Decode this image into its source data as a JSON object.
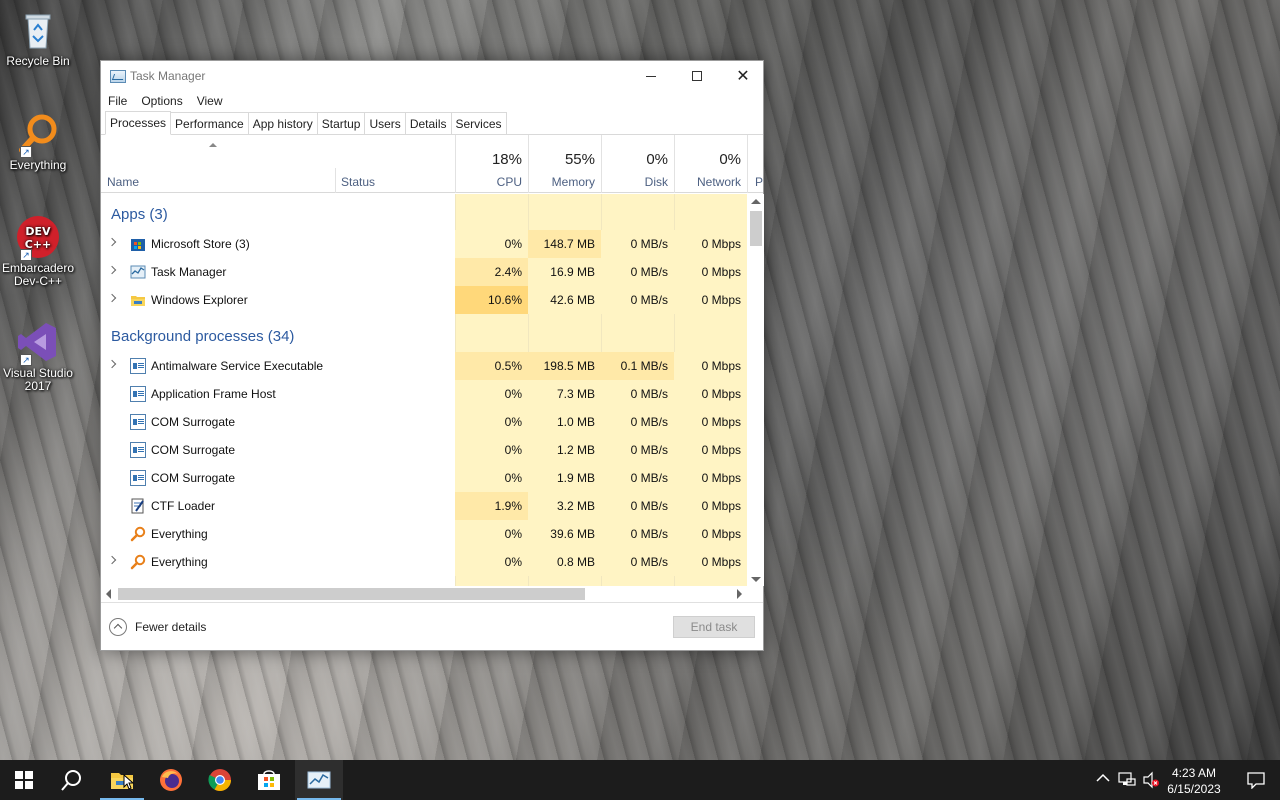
{
  "desktop": {
    "icons": [
      {
        "label": "Recycle Bin"
      },
      {
        "label": "Everything"
      },
      {
        "label": "Embarcadero Dev-C++",
        "badge": "DEV C++"
      },
      {
        "label": "Visual Studio 2017"
      }
    ]
  },
  "window": {
    "title": "Task Manager",
    "menu": [
      "File",
      "Options",
      "View"
    ],
    "tabs": [
      "Processes",
      "Performance",
      "App history",
      "Startup",
      "Users",
      "Details",
      "Services"
    ],
    "active_tab": "Processes"
  },
  "columns": {
    "name": "Name",
    "status": "Status",
    "cpu": {
      "pct": "18%",
      "label": "CPU"
    },
    "memory": {
      "pct": "55%",
      "label": "Memory"
    },
    "disk": {
      "pct": "0%",
      "label": "Disk"
    },
    "network": {
      "pct": "0%",
      "label": "Network"
    },
    "power": "P"
  },
  "groups": {
    "apps": "Apps (3)",
    "background": "Background processes (34)"
  },
  "apps": [
    {
      "name": "Microsoft Store (3)",
      "cpu": "0%",
      "memory": "148.7 MB",
      "disk": "0 MB/s",
      "network": "0 Mbps"
    },
    {
      "name": "Task Manager",
      "cpu": "2.4%",
      "memory": "16.9 MB",
      "disk": "0 MB/s",
      "network": "0 Mbps"
    },
    {
      "name": "Windows Explorer",
      "cpu": "10.6%",
      "memory": "42.6 MB",
      "disk": "0 MB/s",
      "network": "0 Mbps"
    }
  ],
  "background": [
    {
      "name": "Antimalware Service Executable",
      "cpu": "0.5%",
      "memory": "198.5 MB",
      "disk": "0.1 MB/s",
      "network": "0 Mbps"
    },
    {
      "name": "Application Frame Host",
      "cpu": "0%",
      "memory": "7.3 MB",
      "disk": "0 MB/s",
      "network": "0 Mbps"
    },
    {
      "name": "COM Surrogate",
      "cpu": "0%",
      "memory": "1.0 MB",
      "disk": "0 MB/s",
      "network": "0 Mbps"
    },
    {
      "name": "COM Surrogate",
      "cpu": "0%",
      "memory": "1.2 MB",
      "disk": "0 MB/s",
      "network": "0 Mbps"
    },
    {
      "name": "COM Surrogate",
      "cpu": "0%",
      "memory": "1.9 MB",
      "disk": "0 MB/s",
      "network": "0 Mbps"
    },
    {
      "name": "CTF Loader",
      "cpu": "1.9%",
      "memory": "3.2 MB",
      "disk": "0 MB/s",
      "network": "0 Mbps"
    },
    {
      "name": "Everything",
      "cpu": "0%",
      "memory": "39.6 MB",
      "disk": "0 MB/s",
      "network": "0 Mbps"
    },
    {
      "name": "Everything",
      "cpu": "0%",
      "memory": "0.8 MB",
      "disk": "0 MB/s",
      "network": "0 Mbps"
    }
  ],
  "footer": {
    "fewer_details": "Fewer details",
    "end_task": "End task"
  },
  "taskbar": {
    "time": "4:23 AM",
    "date": "6/15/2023"
  },
  "colors": {
    "heat_light": "#fff4c4",
    "heat_medium": "#ffe9a8",
    "heat_strong": "#ffd87a",
    "group_title": "#2c5aa0",
    "taskbar": "#1c1c1c"
  }
}
